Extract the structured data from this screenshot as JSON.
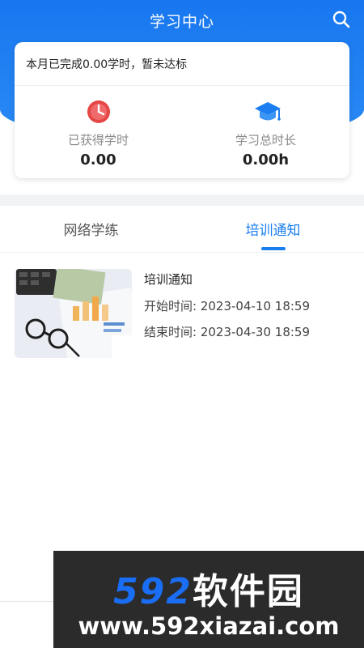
{
  "header": {
    "title": "学习中心",
    "search_icon": "search-icon",
    "background_color": "#1877ef"
  },
  "summary_card": {
    "message": "本月已完成0.00学时，暂未达标",
    "stats": [
      {
        "icon": "clock-icon",
        "icon_color": "#e64646",
        "label": "已获得学时",
        "value": "0.00"
      },
      {
        "icon": "graduation-cap-icon",
        "icon_color": "#1a7ef0",
        "label": "学习总时长",
        "value": "0.00h"
      }
    ]
  },
  "tabs": [
    {
      "label": "网络学练",
      "active": false
    },
    {
      "label": "培训通知",
      "active": true
    }
  ],
  "notices": [
    {
      "title": "培训通知",
      "start_label": "开始时间:",
      "start_value": "2023-04-10 18:59",
      "end_label": "结束时间:",
      "end_value": "2023-04-30 18:59"
    }
  ],
  "watermark": {
    "logo_digits": "592",
    "logo_chars": "软件园",
    "url": "www.592xiazai.com",
    "accent_color": "#1a6ef5"
  }
}
